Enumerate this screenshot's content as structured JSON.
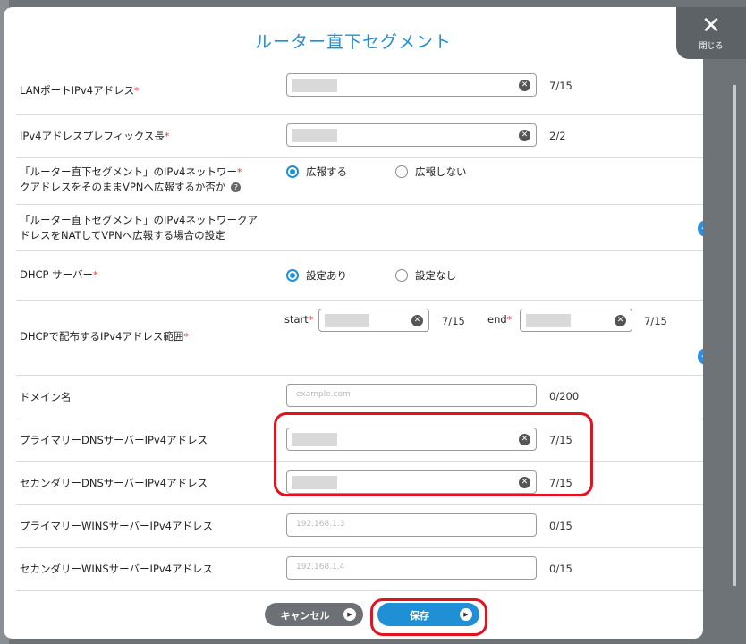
{
  "modal": {
    "title": "ルーター直下セグメント",
    "close_label": "閉じる",
    "close_glyph": "✕"
  },
  "fields": {
    "lan_port": {
      "label": "LANポートIPv4アドレス",
      "count": "7/15"
    },
    "prefix": {
      "label": "IPv4アドレスプレフィックス長",
      "count": "2/2"
    },
    "advertise_vpn": {
      "label_line1": "「ルーター直下セグメント」のIPv4ネットワー",
      "label_line2": "クアドレスをそのままVPNへ広報するか否か",
      "options": [
        "広報する",
        "広報しない"
      ],
      "selected": "広報する"
    },
    "nat_setting": {
      "label_line1": "「ルーター直下セグメント」のIPv4ネットワークア",
      "label_line2": "ドレスをNATしてVPNへ広報する場合の設定"
    },
    "dhcp_server": {
      "label": "DHCP サーバー",
      "options": [
        "設定あり",
        "設定なし"
      ],
      "selected": "設定あり"
    },
    "dhcp_range": {
      "label": "DHCPで配布するIPv4アドレス範囲",
      "start_label": "start",
      "start_count": "7/15",
      "end_label": "end",
      "end_count": "7/15"
    },
    "domain": {
      "label": "ドメイン名",
      "placeholder": "example.com",
      "count": "0/200"
    },
    "primary_dns": {
      "label": "プライマリーDNSサーバーIPv4アドレス",
      "count": "7/15"
    },
    "secondary_dns": {
      "label": "セカンダリーDNSサーバーIPv4アドレス",
      "count": "7/15"
    },
    "primary_wins": {
      "label": "プライマリーWINSサーバーIPv4アドレス",
      "placeholder": "192.168.1.3",
      "count": "0/15"
    },
    "secondary_wins": {
      "label": "セカンダリーWINSサーバーIPv4アドレス",
      "placeholder": "192.168.1.4",
      "count": "0/15"
    }
  },
  "required_mark": "*",
  "help_glyph": "?",
  "plus_glyph": "+",
  "clear_glyph": "✕",
  "footer": {
    "cancel_label": "キャンセル",
    "save_label": "保存",
    "arrow_glyph": "▶"
  },
  "colors": {
    "accent": "#1f8fd6",
    "highlight": "#e5111f",
    "cancel": "#6d7175"
  }
}
